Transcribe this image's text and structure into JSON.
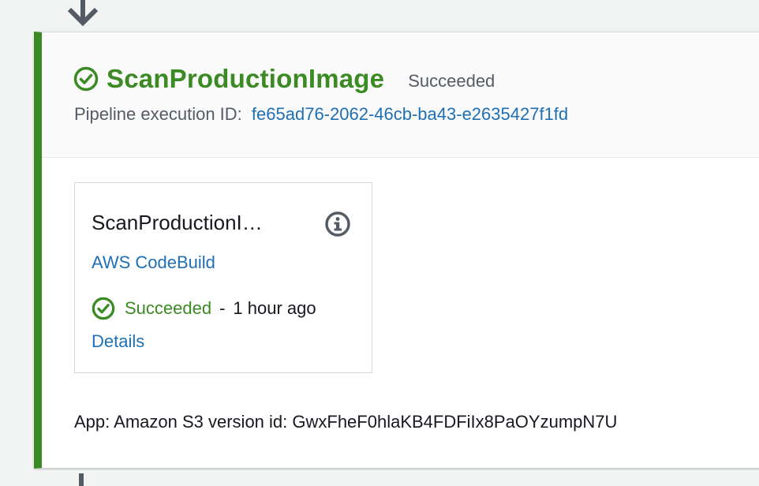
{
  "stage": {
    "name": "ScanProductionImage",
    "status": "Succeeded",
    "execution_label": "Pipeline execution ID:",
    "execution_id": "fe65ad76-2062-46cb-ba43-e2635427f1fd",
    "status_icon": "check-circle-icon",
    "accent_color": "#3b8a23"
  },
  "action": {
    "name": "ScanProductionI…",
    "info_icon": "info-icon",
    "provider": "AWS CodeBuild",
    "status": "Succeeded",
    "separator": "-",
    "time": "1 hour ago",
    "details": "Details",
    "status_icon": "check-circle-icon"
  },
  "source": {
    "text": "App: Amazon S3 version id: GwxFheF0hlaKB4FDFiIx8PaOYzumpN7U"
  },
  "colors": {
    "success": "#3b8a23",
    "link": "#1f6fb5",
    "muted": "#545b64"
  }
}
